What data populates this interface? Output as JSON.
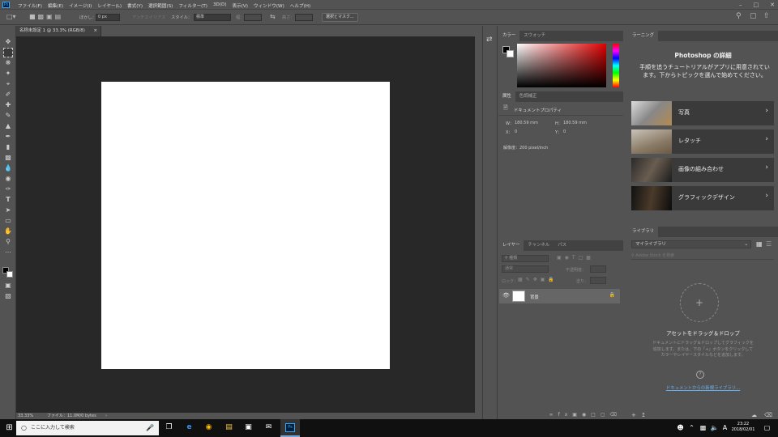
{
  "app": {
    "logo": "Ps"
  },
  "menu": [
    "ファイル(F)",
    "編集(E)",
    "イメージ(I)",
    "レイヤー(L)",
    "書式(Y)",
    "選択範囲(S)",
    "フィルター(T)",
    "3D(D)",
    "表示(V)",
    "ウィンドウ(W)",
    "ヘルプ(H)"
  ],
  "options": {
    "feather_label": "ぼかし：",
    "feather_value": "0 px",
    "antialias": "アンチエイリアス",
    "style_label": "スタイル：",
    "style_value": "標準",
    "width_label": "幅：",
    "height_label": "高さ：",
    "select_mask_button": "選択とマスク..."
  },
  "document": {
    "tab_title": "名称未設定 1 @ 33.3% (RGB/8)",
    "zoom": "33.33%",
    "file_info": "ファイル：11.0M/0 bytes"
  },
  "color_panel": {
    "tabs": [
      "カラー",
      "スウォッチ"
    ]
  },
  "properties_panel": {
    "tabs": [
      "属性",
      "色調補正"
    ],
    "title": "ドキュメントプロパティ",
    "w_label": "W：",
    "w_value": "180.59 mm",
    "h_label": "H：",
    "h_value": "180.59 mm",
    "x_label": "X：",
    "x_value": "0",
    "y_label": "Y：",
    "y_value": "0",
    "resolution": "解像度：200 pixel/inch"
  },
  "layers_panel": {
    "tabs": [
      "レイヤー",
      "チャンネル",
      "パス"
    ],
    "filter_label": "種類",
    "blend_mode": "通常",
    "opacity_label": "不透明度：",
    "lock_label": "ロック：",
    "fill_label": "塗り：",
    "layer_name": "背景"
  },
  "learn_panel": {
    "tab": "ラーニング",
    "heading": "Photoshop の詳細",
    "description": "手順を追うチュートリアルがアプリに用意されています。下からトピックを選んで始めてください。",
    "cards": [
      "写真",
      "レタッチ",
      "画像の組み合わせ",
      "グラフィックデザイン"
    ]
  },
  "library_panel": {
    "tab": "ライブラリ",
    "library_name": "マイライブラリ",
    "search_placeholder": "Adobe Stock を検索",
    "drop_title": "アセットをドラッグ＆ドロップ",
    "drop_text": "ドキュメントにドラッグ＆ドロップしてグラフィックを追加します。または、下の「+」ボタンをクリックしてカラーやレイヤースタイルなどを追加します。",
    "link": "ドキュメントからの新規ライブラリ..."
  },
  "taskbar": {
    "search_placeholder": "ここに入力して検索",
    "time": "23:22",
    "date": "2018/02/01",
    "ime": "A"
  }
}
